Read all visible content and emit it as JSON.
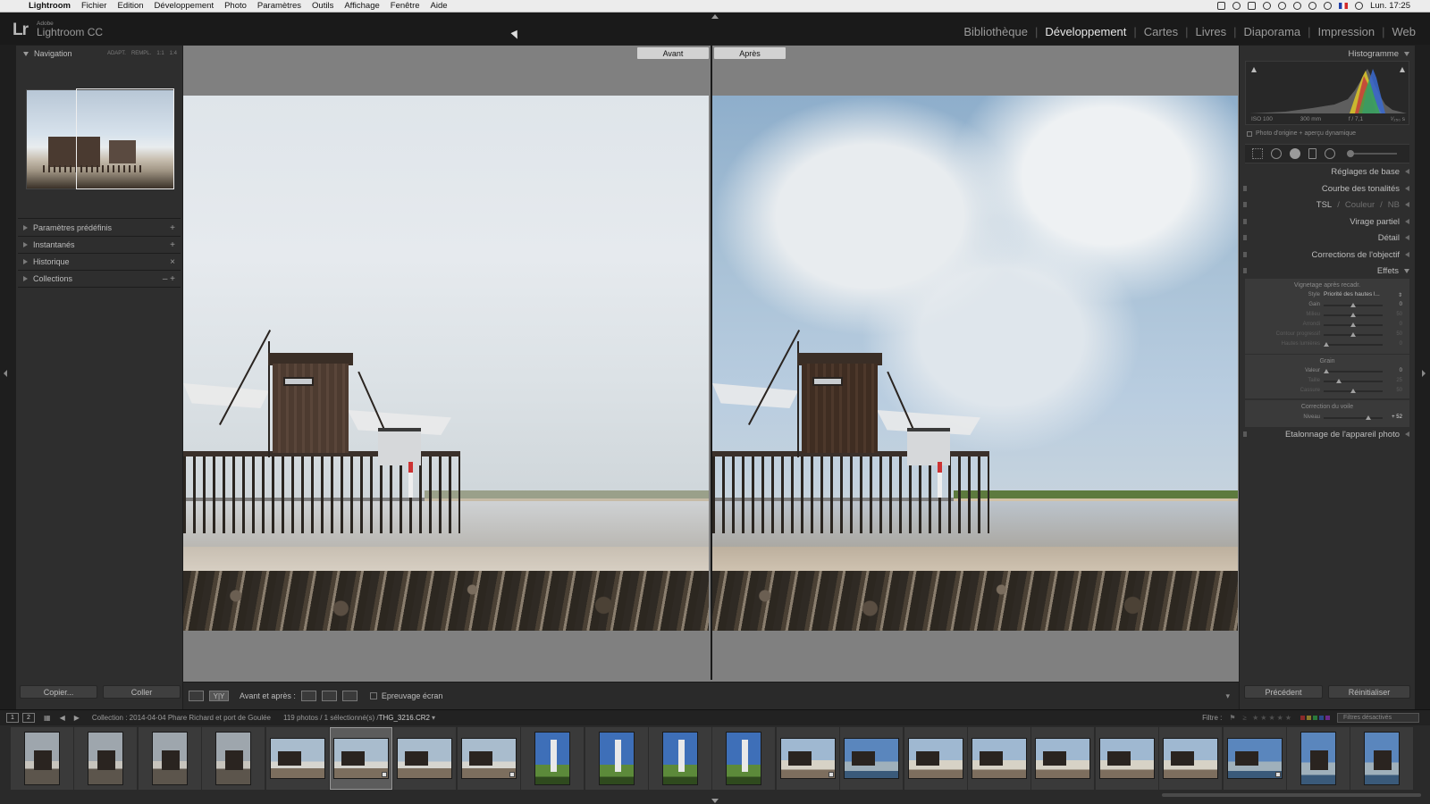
{
  "menubar": {
    "app": "Lightroom",
    "items": [
      "Fichier",
      "Edition",
      "Développement",
      "Photo",
      "Paramètres",
      "Outils",
      "Affichage",
      "Fenêtre",
      "Aide"
    ],
    "clock": "Lun. 17:25"
  },
  "header": {
    "logo": "Lr",
    "brand_small": "Adobe",
    "brand_name": "Lightroom CC",
    "modules": [
      "Bibliothèque",
      "Développement",
      "Cartes",
      "Livres",
      "Diaporama",
      "Impression",
      "Web"
    ],
    "active_module": "Développement"
  },
  "left_panel": {
    "navigator": {
      "title": "Navigation",
      "modes": [
        "ADAPT.",
        "REMPL.",
        "1:1",
        "1:4"
      ]
    },
    "sections": [
      {
        "label": "Paramètres prédéfinis",
        "action": "+"
      },
      {
        "label": "Instantanés",
        "action": "+"
      },
      {
        "label": "Historique",
        "action": "×"
      },
      {
        "label": "Collections",
        "action": "– +"
      }
    ],
    "copy_label": "Copier...",
    "paste_label": "Coller"
  },
  "center": {
    "before_label": "Avant",
    "after_label": "Après",
    "toolbar": {
      "view_label": "Avant et après :",
      "proof_label": "Epreuvage écran",
      "yy_label": "Y|Y"
    }
  },
  "right_panel": {
    "histogram": {
      "title": "Histogramme",
      "iso": "ISO 100",
      "focal": "300 mm",
      "aperture": "f / 7,1",
      "shutter": "¹⁄₂₅₀ s",
      "original_label": "Photo d'origine + aperçu dynamique"
    },
    "panels": {
      "basic": "Réglages de base",
      "tone": "Courbe des tonalités",
      "hsl": "TSL",
      "hsl_color": "Couleur",
      "hsl_bw": "NB",
      "split": "Virage partiel",
      "detail": "Détail",
      "lens": "Corrections de l'objectif",
      "effects": "Effets",
      "calibration": "Etalonnage de l'appareil photo"
    },
    "vignette": {
      "title": "Vignetage après recadr.",
      "style_label": "Style",
      "style_value": "Priorité des hautes l...",
      "sliders": [
        {
          "label": "Gain",
          "value": "0",
          "pos": 0.5,
          "dim": false
        },
        {
          "label": "Milieu",
          "value": "50",
          "pos": 0.5,
          "dim": true
        },
        {
          "label": "Arrondi",
          "value": "0",
          "pos": 0.5,
          "dim": true
        },
        {
          "label": "Contour progressif",
          "value": "50",
          "pos": 0.5,
          "dim": true
        },
        {
          "label": "Hautes lumières",
          "value": "0",
          "pos": 0.05,
          "dim": true
        }
      ]
    },
    "grain": {
      "title": "Grain",
      "sliders": [
        {
          "label": "Valeur",
          "value": "0",
          "pos": 0.05,
          "dim": false
        },
        {
          "label": "Taille",
          "value": "25",
          "pos": 0.25,
          "dim": true
        },
        {
          "label": "Cassure",
          "value": "50",
          "pos": 0.5,
          "dim": true
        }
      ]
    },
    "dehaze": {
      "title": "Correction du voile",
      "label": "Niveau",
      "value": "+ 52",
      "pos": 0.76
    },
    "prev_label": "Précédent",
    "reset_label": "Réinitialiser"
  },
  "filmstrip_bar": {
    "page1": "1",
    "page2": "2",
    "collection_text": "Collection : 2014-04-04 Phare Richard et port de Goulée",
    "count_text": "119 photos / 1 sélectionné(s) /",
    "filename": "THG_3216.CR2",
    "filter_label": "Filtre :",
    "filter_value": "Filtres désactivés"
  },
  "filmstrip": {
    "thumbs": [
      {
        "kind": "mono",
        "portrait": true,
        "badge": false
      },
      {
        "kind": "mono",
        "portrait": true,
        "badge": false
      },
      {
        "kind": "mono",
        "portrait": true,
        "badge": false
      },
      {
        "kind": "mono",
        "portrait": true,
        "badge": false
      },
      {
        "kind": "land",
        "portrait": false,
        "badge": false
      },
      {
        "kind": "land",
        "portrait": false,
        "badge": true,
        "selected": true
      },
      {
        "kind": "land",
        "portrait": false,
        "badge": false
      },
      {
        "kind": "land",
        "portrait": false,
        "badge": true
      },
      {
        "kind": "light",
        "portrait": true,
        "badge": false
      },
      {
        "kind": "light",
        "portrait": true,
        "badge": false
      },
      {
        "kind": "light",
        "portrait": true,
        "badge": false
      },
      {
        "kind": "light",
        "portrait": true,
        "badge": false
      },
      {
        "kind": "hut-t",
        "portrait": false,
        "badge": true
      },
      {
        "kind": "hut-t2",
        "portrait": false,
        "badge": false
      },
      {
        "kind": "hut-t",
        "portrait": false,
        "badge": false
      },
      {
        "kind": "hut-t",
        "portrait": false,
        "badge": false
      },
      {
        "kind": "hut-t",
        "portrait": false,
        "badge": false
      },
      {
        "kind": "hut-t",
        "portrait": false,
        "badge": false
      },
      {
        "kind": "hut-t",
        "portrait": false,
        "badge": false
      },
      {
        "kind": "hut-t2",
        "portrait": false,
        "badge": true
      },
      {
        "kind": "hut-t2",
        "portrait": true,
        "badge": false
      },
      {
        "kind": "hut-t2",
        "portrait": true,
        "badge": false
      }
    ]
  },
  "colors": {
    "accent": "#e8e8e8",
    "panel_bg": "#2e2e2e",
    "center_bg": "#808080"
  }
}
